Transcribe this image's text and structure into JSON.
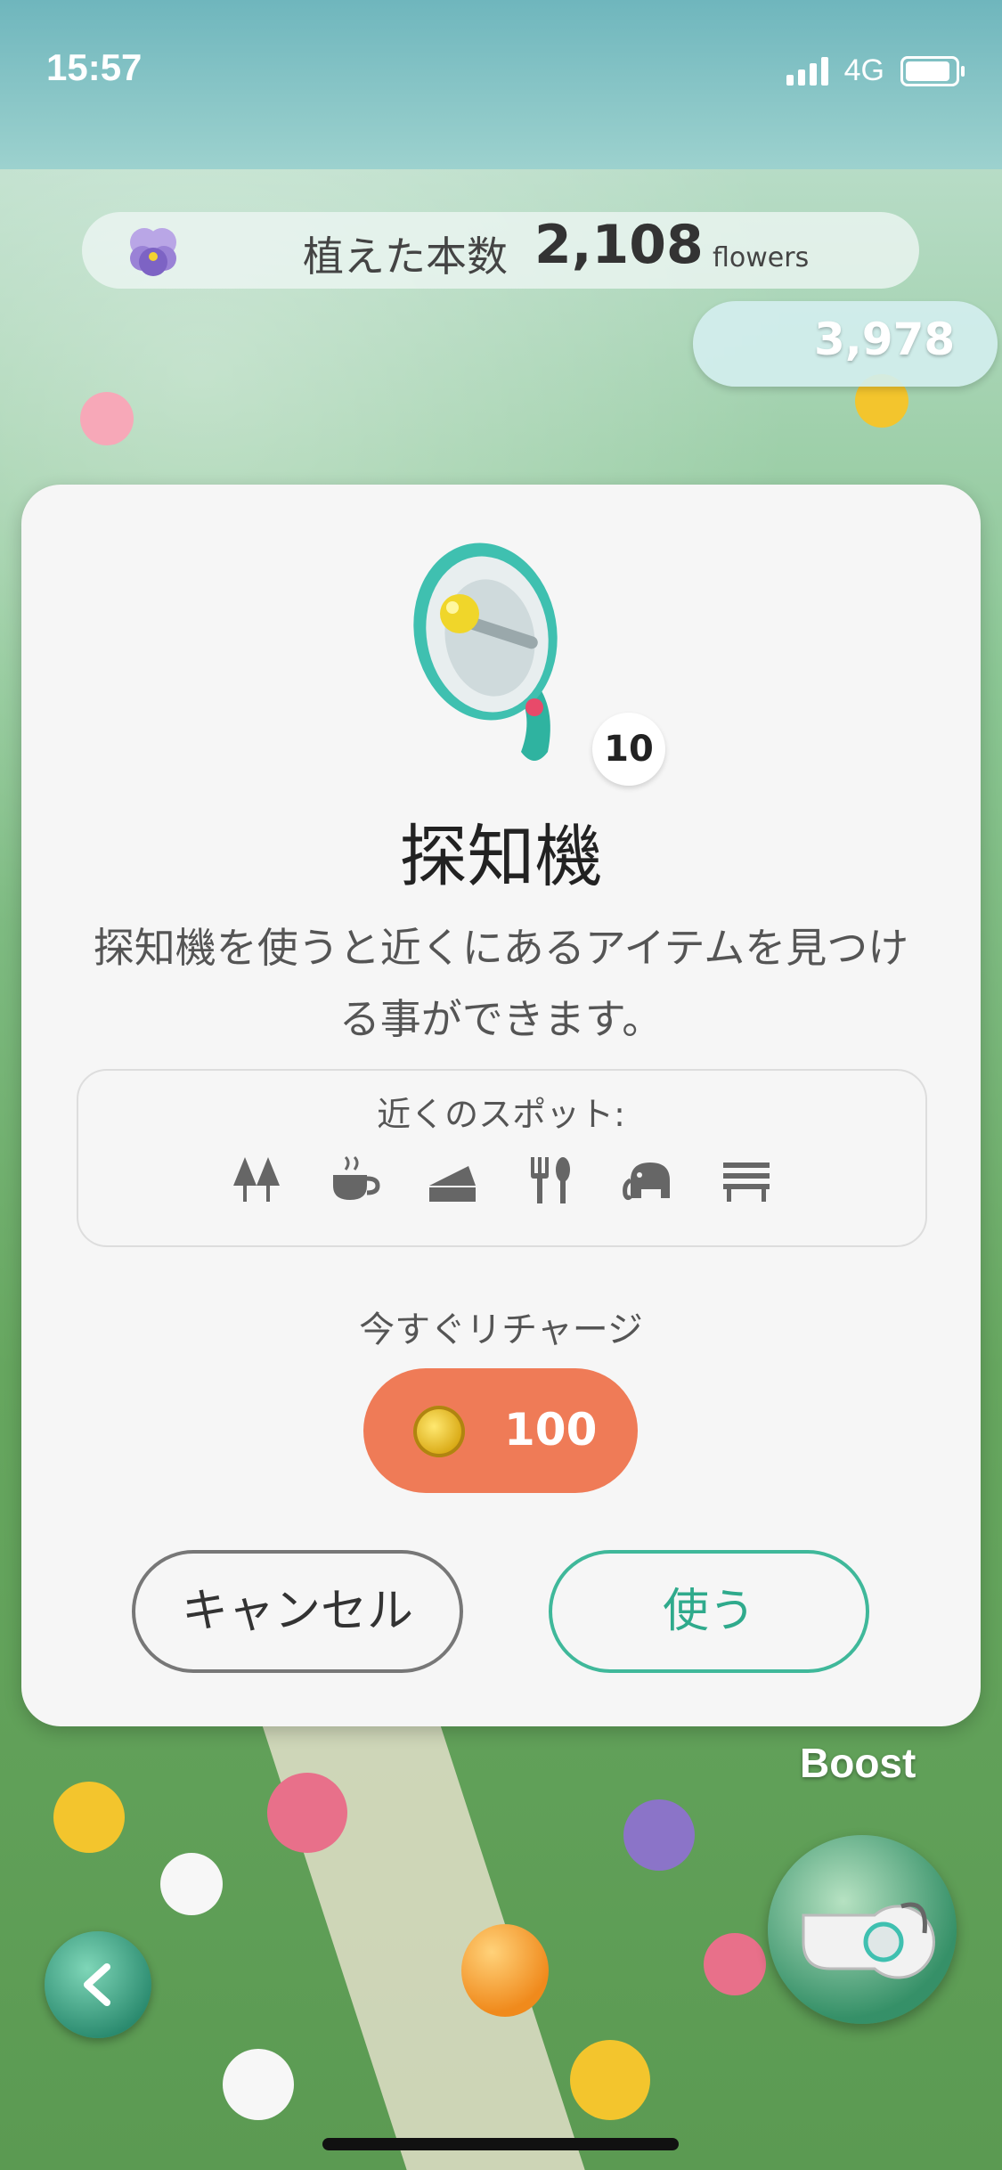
{
  "status_bar": {
    "time": "15:57",
    "network": "4G",
    "battery_level": 0.9
  },
  "header": {
    "planted_label": "植えた本数",
    "planted_count": "2,108",
    "planted_unit": "flowers",
    "coin_balance": "3,978"
  },
  "modal": {
    "item_quantity": "10",
    "item_title": "探知機",
    "item_description": "探知機を使うと近くにあるアイテムを見つける事ができます。",
    "spots_title": "近くのスポット:",
    "spot_icons": [
      "trees-icon",
      "coffee-cup-icon",
      "cake-slice-icon",
      "restaurant-icon",
      "elephant-icon",
      "bench-icon"
    ],
    "recharge_label": "今すぐリチャージ",
    "recharge_price": "100",
    "cancel_label": "キャンセル",
    "use_label": "使う"
  },
  "overlay": {
    "boost_label": "Boost"
  },
  "colors": {
    "accent_teal": "#3fb89a",
    "recharge_orange": "#ef7b57",
    "modal_bg": "#f6f6f6"
  }
}
